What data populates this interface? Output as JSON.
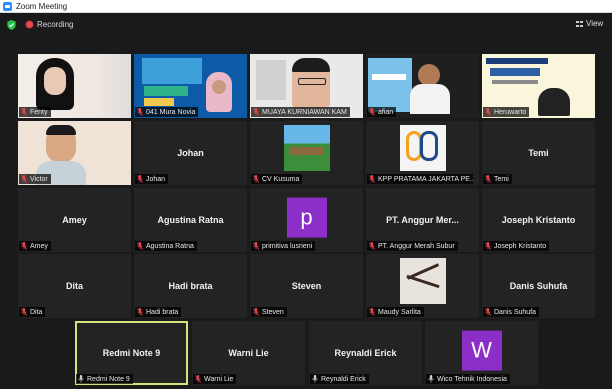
{
  "window": {
    "title": "Zoom Meeting"
  },
  "toolbar": {
    "recording_label": "Recording",
    "view_label": "View"
  },
  "colors": {
    "active_speaker_border": "#d6e27b",
    "muted_icon": "#e5484d",
    "avatar_purple": "#8c2fc8"
  },
  "participants": [
    {
      "name": "Fenty",
      "muted": true,
      "display": "video"
    },
    {
      "name": "041 Mura Novia",
      "muted": true,
      "display": "video"
    },
    {
      "name": "MUAYA KURNIAWAN KAM",
      "muted": true,
      "display": "video"
    },
    {
      "name": "afian",
      "muted": true,
      "display": "video"
    },
    {
      "name": "Heruwarto",
      "muted": true,
      "display": "video"
    },
    {
      "name": "Victor",
      "muted": true,
      "display": "video"
    },
    {
      "name": "Johan",
      "center_name": "Johan",
      "muted": true,
      "display": "name"
    },
    {
      "name": "CV Kusuma",
      "muted": true,
      "display": "picture"
    },
    {
      "name": "KPP PRATAMA JAKARTA PE...",
      "muted": true,
      "display": "picture"
    },
    {
      "name": "Temi",
      "center_name": "Temi",
      "muted": true,
      "display": "name"
    },
    {
      "name": "Amey",
      "center_name": "Amey",
      "muted": true,
      "display": "name"
    },
    {
      "name": "Agustina Ratna",
      "center_name": "Agustina Ratna",
      "muted": true,
      "display": "name"
    },
    {
      "name": "primitiva lusrieni",
      "avatar_letter": "p",
      "muted": true,
      "display": "avatar"
    },
    {
      "name": "PT. Anggur Merah Subur",
      "center_name": "PT. Anggur Mer...",
      "muted": true,
      "display": "name"
    },
    {
      "name": "Joseph Kristanto",
      "center_name": "Joseph Kristanto",
      "muted": true,
      "display": "name"
    },
    {
      "name": "Dita",
      "center_name": "Dita",
      "muted": true,
      "display": "name"
    },
    {
      "name": "Hadi brata",
      "center_name": "Hadi brata",
      "muted": true,
      "display": "name"
    },
    {
      "name": "Steven",
      "center_name": "Steven",
      "muted": true,
      "display": "name"
    },
    {
      "name": "Maudy Sarlita",
      "muted": true,
      "display": "picture"
    },
    {
      "name": "Danis Suhufa",
      "center_name": "Danis Suhufa",
      "muted": true,
      "display": "name"
    },
    {
      "name": "Redmi Note 9",
      "center_name": "Redmi Note 9",
      "muted": false,
      "display": "name",
      "active_speaker": true
    },
    {
      "name": "Warni Lie",
      "center_name": "Warni Lie",
      "muted": true,
      "display": "name"
    },
    {
      "name": "Reynaldi Erick",
      "center_name": "Reynaldi Erick",
      "muted": false,
      "display": "name"
    },
    {
      "name": "Wico Tehnik Indonesia",
      "avatar_letter": "W",
      "muted": false,
      "display": "avatar"
    }
  ]
}
